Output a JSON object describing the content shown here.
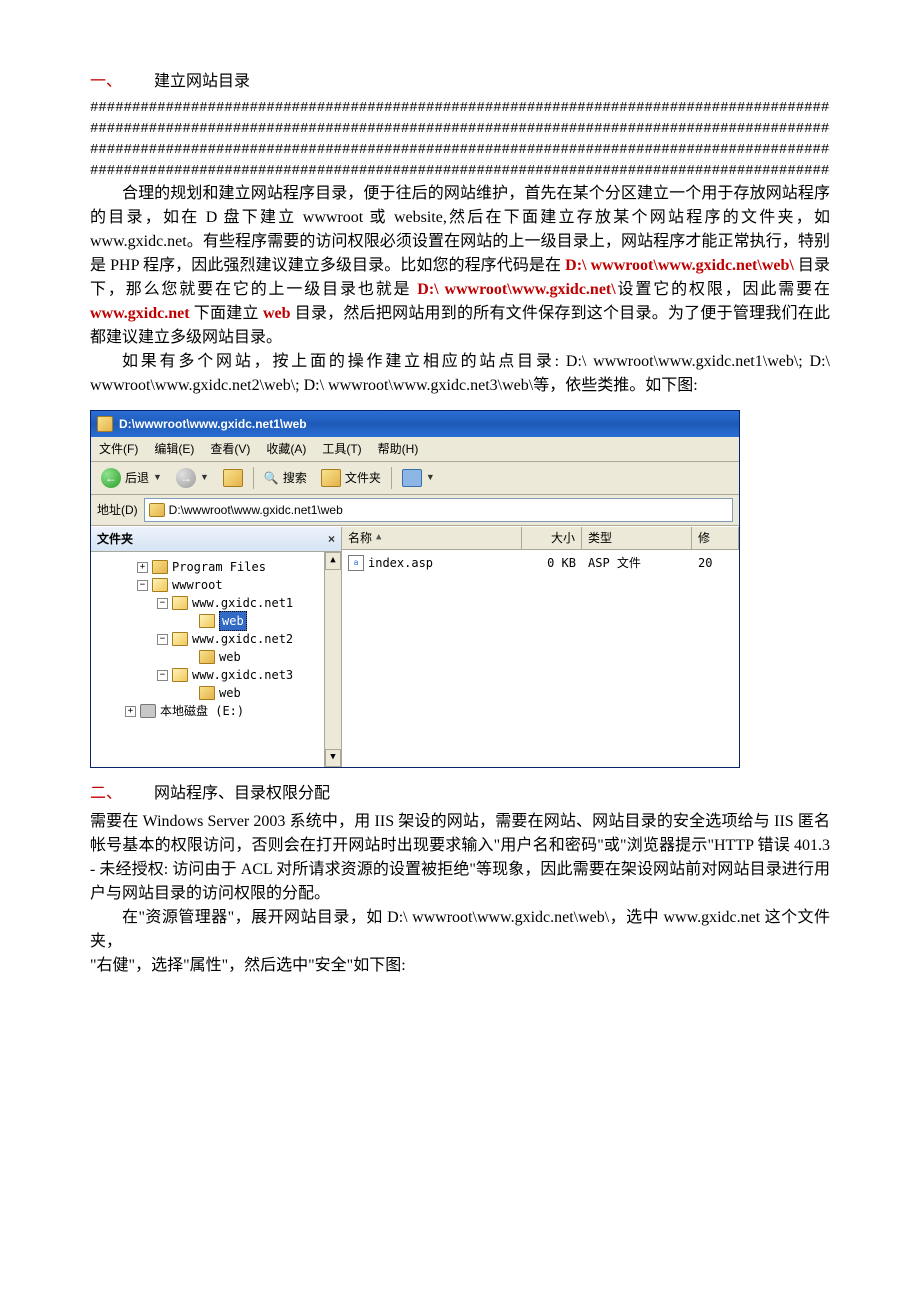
{
  "section1": {
    "num": "一、",
    "title": "建立网站目录",
    "hashes": "##########################################################################################",
    "p1_pre": "合理的规划和建立网站程序目录，便于往后的网站维护，首先在某个分区建立一个用于存放网站程序的目录，如在 D 盘下建立 wwwroot 或 website,然后在下面建立存放某个网站程序的文件夹，如 www.gxidc.net。有些程序需要的访问权限必须设置在网站的上一级目录上，网站程序才能正常执行，特别是 PHP 程序，因此强烈建议建立多级目录。比如您的程序代码是在 ",
    "p1_red1": "D:\\ wwwroot\\www.gxidc.net\\web\\",
    "p1_mid1": " 目录下，那么您就要在它的上一级目录也就是 ",
    "p1_red2": "D:\\ wwwroot\\www.gxidc.net\\",
    "p1_mid2": "设置它的权限，因此需要在 ",
    "p1_red3": "www.gxidc.net",
    "p1_mid3": " 下面建立 ",
    "p1_red4": "web",
    "p1_mid4": " 目录，然后把网站用到的所有文件保存到这个目录。为了便于管理我们在此都建议建立多级网站目录。",
    "p2": "如果有多个网站，按上面的操作建立相应的站点目录: D:\\ wwwroot\\www.gxidc.net1\\web\\; D:\\ wwwroot\\www.gxidc.net2\\web\\; D:\\ wwwroot\\www.gxidc.net3\\web\\等，依些类推。如下图:"
  },
  "explorer": {
    "title": "D:\\wwwroot\\www.gxidc.net1\\web",
    "menu": {
      "file": "文件(F)",
      "edit": "编辑(E)",
      "view": "查看(V)",
      "fav": "收藏(A)",
      "tools": "工具(T)",
      "help": "帮助(H)"
    },
    "toolbar": {
      "back": "后退",
      "search": "搜索",
      "folders": "文件夹"
    },
    "address_label": "地址(D)",
    "address_value": "D:\\wwwroot\\www.gxidc.net1\\web",
    "tree": {
      "header": "文件夹",
      "items": [
        {
          "indent": 40,
          "pm": "+",
          "icon": "folder",
          "label": "Program Files"
        },
        {
          "indent": 40,
          "pm": "-",
          "icon": "folder-open",
          "label": "wwwroot"
        },
        {
          "indent": 60,
          "pm": "-",
          "icon": "folder-open",
          "label": "www.gxidc.net1"
        },
        {
          "indent": 88,
          "pm": "",
          "icon": "folder-open",
          "label": "web",
          "selected": true
        },
        {
          "indent": 60,
          "pm": "-",
          "icon": "folder-open",
          "label": "www.gxidc.net2"
        },
        {
          "indent": 88,
          "pm": "",
          "icon": "folder",
          "label": "web"
        },
        {
          "indent": 60,
          "pm": "-",
          "icon": "folder-open",
          "label": "www.gxidc.net3"
        },
        {
          "indent": 88,
          "pm": "",
          "icon": "folder",
          "label": "web"
        },
        {
          "indent": 28,
          "pm": "+",
          "icon": "disk",
          "label": "本地磁盘 (E:)"
        }
      ]
    },
    "list": {
      "cols": {
        "name": "名称",
        "size": "大小",
        "type": "类型",
        "mod": "修"
      },
      "rows": [
        {
          "name": "index.asp",
          "size": "0 KB",
          "type": "ASP 文件",
          "mod": "20"
        }
      ]
    }
  },
  "section2": {
    "num": "二、",
    "title": "网站程序、目录权限分配",
    "p1": "需要在 Windows Server 2003 系统中，用 IIS 架设的网站，需要在网站、网站目录的安全选项给与 IIS 匿名帐号基本的权限访问，否则会在打开网站时出现要求输入\"用户名和密码\"或\"浏览器提示\"HTTP 错误 401.3 - 未经授权: 访问由于 ACL 对所请求资源的设置被拒绝\"等现象，因此需要在架设网站前对网站目录进行用户与网站目录的访问权限的分配。",
    "p2": "在\"资源管理器\"，展开网站目录，如 D:\\ wwwroot\\www.gxidc.net\\web\\，选中 www.gxidc.net 这个文件夹，",
    "p3": "\"右健\"，选择\"属性\"，然后选中\"安全\"如下图:"
  }
}
